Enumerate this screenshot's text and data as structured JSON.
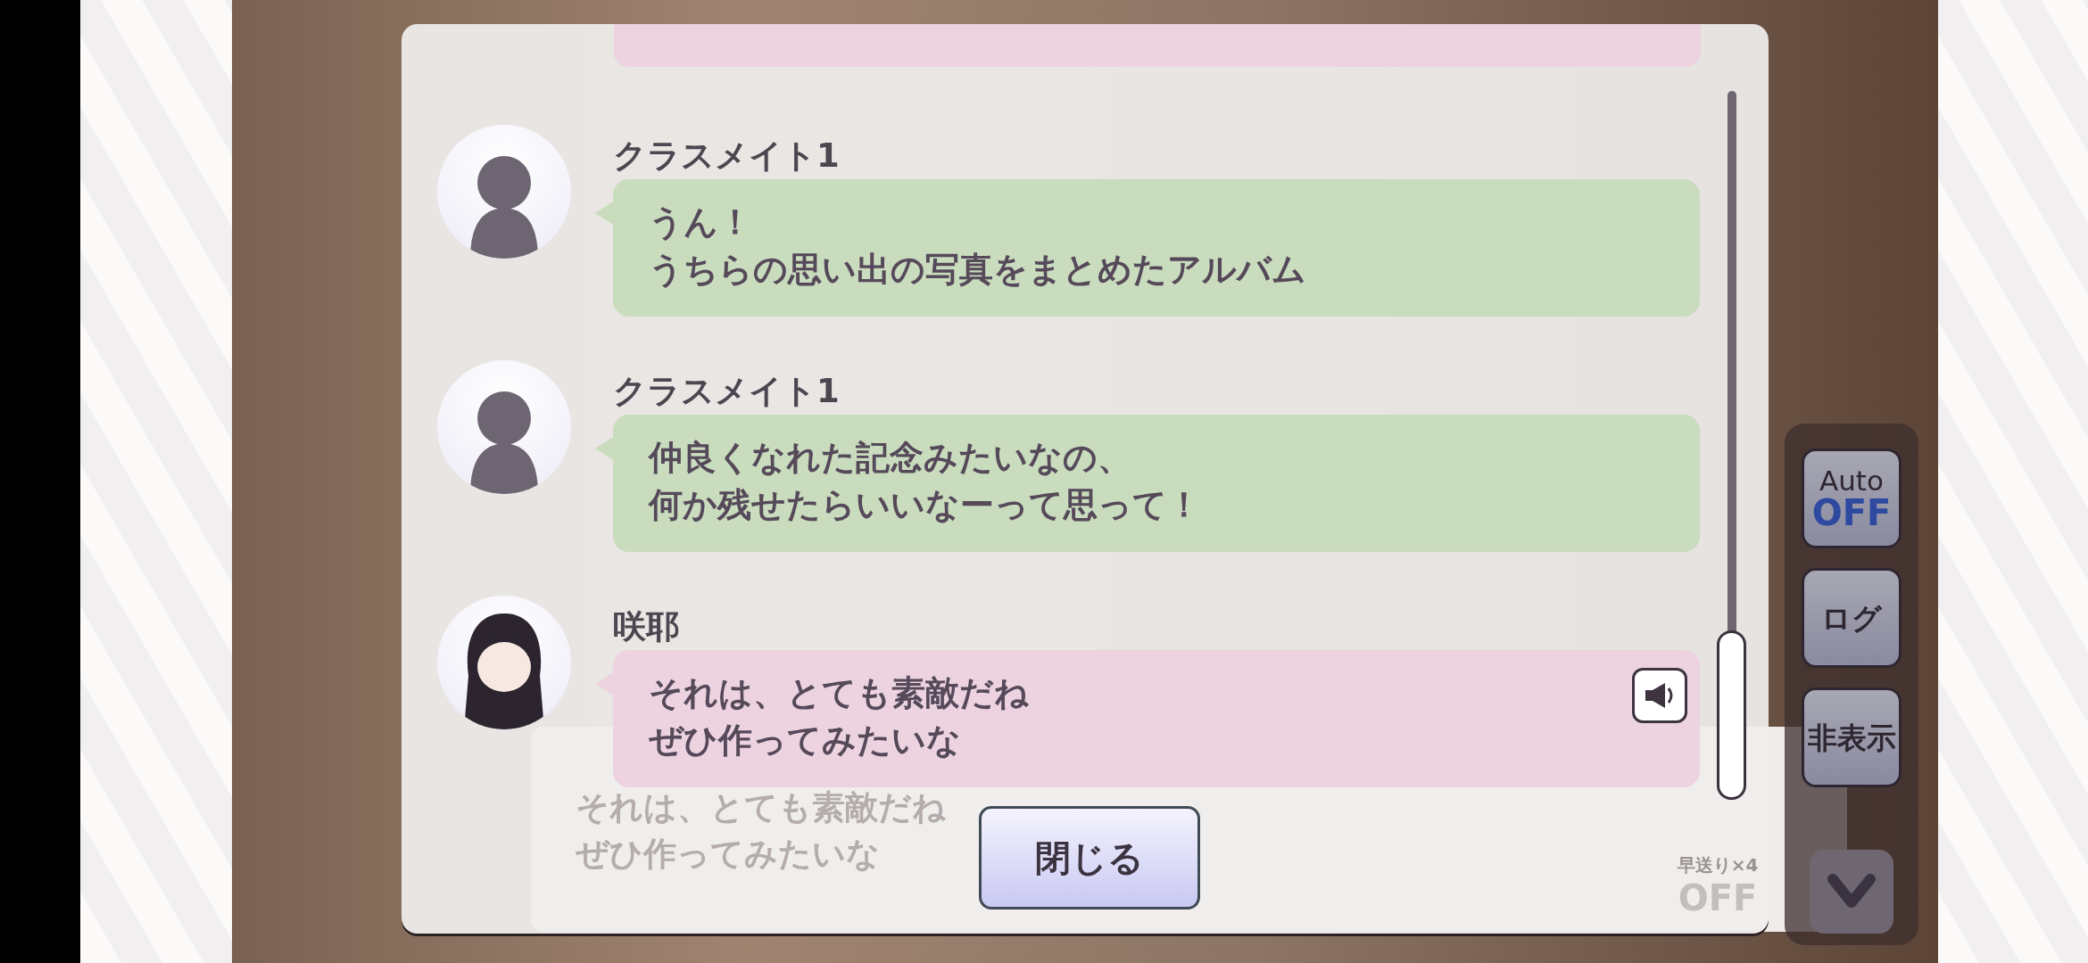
{
  "dialog": {
    "messages": [
      {
        "speaker": "クラスメイト1",
        "kind": "classmate",
        "lines": [
          "うん！",
          "うちらの思い出の写真をまとめたアルバム"
        ],
        "voice": false
      },
      {
        "speaker": "クラスメイト1",
        "kind": "classmate",
        "lines": [
          "仲良くなれた記念みたいなの、",
          "何か残せたらいいなーって思って！"
        ],
        "voice": false
      },
      {
        "speaker": "咲耶",
        "kind": "main",
        "lines": [
          "それは、とても素敵だね",
          "ぜひ作ってみたいな"
        ],
        "voice": true
      }
    ],
    "close_button": "閉じる"
  },
  "side_buttons": [
    {
      "kind": "auto",
      "label": "Auto",
      "state": "OFF"
    },
    {
      "kind": "text",
      "label": "ログ"
    },
    {
      "kind": "text",
      "label": "非表示"
    },
    {
      "kind": "chevron"
    }
  ],
  "background": {
    "lines": [
      "それは、とても素敵だね",
      "ぜひ作ってみたいな"
    ],
    "fast_forward": "早送り×4",
    "fast_forward_state": "OFF"
  }
}
